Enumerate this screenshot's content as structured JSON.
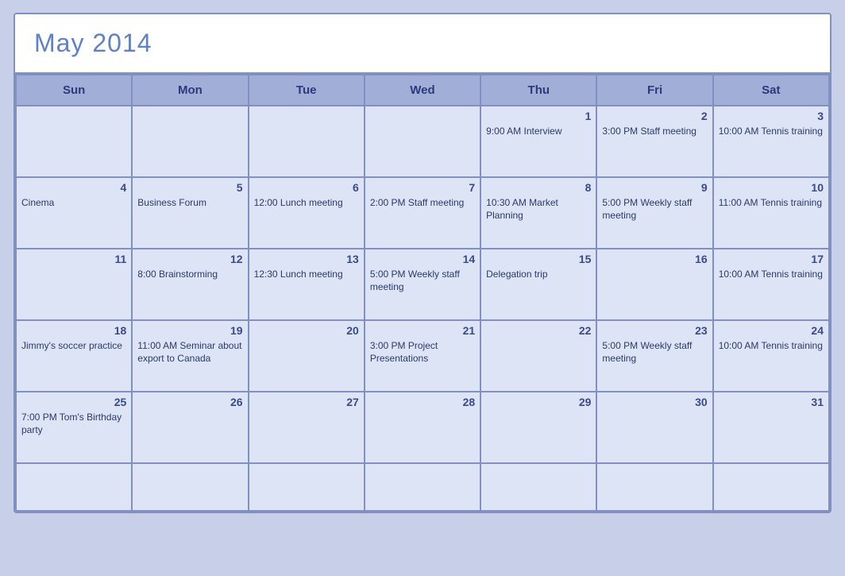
{
  "title": "May 2014",
  "headers": [
    "Sun",
    "Mon",
    "Tue",
    "Wed",
    "Thu",
    "Fri",
    "Sat"
  ],
  "weeks": [
    [
      {
        "date": "",
        "event": ""
      },
      {
        "date": "",
        "event": ""
      },
      {
        "date": "",
        "event": ""
      },
      {
        "date": "",
        "event": ""
      },
      {
        "date": "1",
        "event": "9:00 AM Interview"
      },
      {
        "date": "2",
        "event": "3:00 PM Staff meeting"
      },
      {
        "date": "3",
        "event": "10:00 AM Tennis training"
      }
    ],
    [
      {
        "date": "4",
        "event": "Cinema"
      },
      {
        "date": "5",
        "event": "Business Forum"
      },
      {
        "date": "6",
        "event": "12:00 Lunch meeting"
      },
      {
        "date": "7",
        "event": "2:00 PM Staff meeting"
      },
      {
        "date": "8",
        "event": "10:30 AM Market Planning"
      },
      {
        "date": "9",
        "event": "5:00 PM Weekly staff meeting"
      },
      {
        "date": "10",
        "event": "11:00 AM Tennis training"
      }
    ],
    [
      {
        "date": "11",
        "event": ""
      },
      {
        "date": "12",
        "event": "8:00 Brainstorming"
      },
      {
        "date": "13",
        "event": "12:30 Lunch meeting"
      },
      {
        "date": "14",
        "event": "5:00 PM Weekly staff meeting"
      },
      {
        "date": "15",
        "event": "Delegation trip"
      },
      {
        "date": "16",
        "event": ""
      },
      {
        "date": "17",
        "event": "10:00 AM Tennis training"
      }
    ],
    [
      {
        "date": "18",
        "event": "Jimmy's soccer practice"
      },
      {
        "date": "19",
        "event": "11:00 AM Seminar about export to Canada"
      },
      {
        "date": "20",
        "event": ""
      },
      {
        "date": "21",
        "event": "3:00 PM Project Presentations"
      },
      {
        "date": "22",
        "event": ""
      },
      {
        "date": "23",
        "event": "5:00 PM Weekly staff meeting"
      },
      {
        "date": "24",
        "event": "10:00 AM Tennis training"
      }
    ],
    [
      {
        "date": "25",
        "event": "7:00 PM Tom's Birthday party"
      },
      {
        "date": "26",
        "event": ""
      },
      {
        "date": "27",
        "event": ""
      },
      {
        "date": "28",
        "event": ""
      },
      {
        "date": "29",
        "event": ""
      },
      {
        "date": "30",
        "event": ""
      },
      {
        "date": "31",
        "event": ""
      }
    ],
    [
      {
        "date": "",
        "event": ""
      },
      {
        "date": "",
        "event": ""
      },
      {
        "date": "",
        "event": ""
      },
      {
        "date": "",
        "event": ""
      },
      {
        "date": "",
        "event": ""
      },
      {
        "date": "",
        "event": ""
      },
      {
        "date": "",
        "event": ""
      }
    ]
  ]
}
